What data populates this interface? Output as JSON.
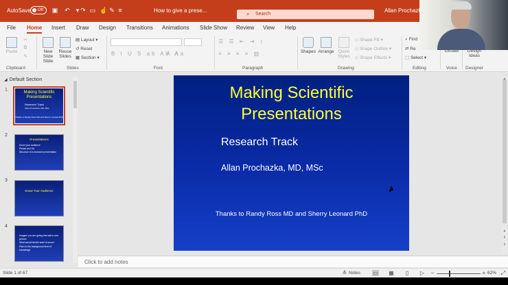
{
  "titlebar": {
    "autosave_label": "AutoSave",
    "autosave_state": "Off",
    "doc_title": "How to give a prese...",
    "search_placeholder": "Search",
    "user_name": "Allan Prochazka",
    "accent_color": "#c43e1c"
  },
  "tabs": [
    "File",
    "Home",
    "Insert",
    "Draw",
    "Design",
    "Transitions",
    "Animations",
    "Slide Show",
    "Review",
    "View",
    "Help"
  ],
  "active_tab": "Home",
  "ribbon": {
    "clipboard": {
      "paste": "Paste",
      "label": "Clipboard"
    },
    "slides": {
      "new_slide": "New Slide",
      "new_slide_2": "Slide",
      "reuse_slides": "Reuse",
      "reuse_slides_2": "Slides",
      "layout": "Layout",
      "reset": "Reset",
      "section": "Section",
      "label": "Slides"
    },
    "font": {
      "label": "Font"
    },
    "paragraph": {
      "label": "Paragraph"
    },
    "drawing": {
      "shapes": "Shapes",
      "arrange": "Arrange",
      "quick_styles": "Quick",
      "quick_styles_2": "Styles",
      "shape_fill": "Shape Fill",
      "shape_outline": "Shape Outline",
      "shape_effects": "Shape Effects",
      "label": "Drawing"
    },
    "editing": {
      "find": "Find",
      "replace": "Re",
      "select": "Select",
      "label": "Editing"
    },
    "voice": {
      "dictate": "Dictate",
      "label": "Voice"
    },
    "designer": {
      "design_ideas": "Design",
      "design_ideas_2": "Ideas",
      "label": "Designer"
    }
  },
  "section_name": "Default Section",
  "thumbnails": [
    {
      "number": "1",
      "title": "Making Scientific Presentations",
      "subtitle": "Research Track",
      "line": "Allan Prochazka, MD, MSc",
      "footer": "Thanks to Randy Ross MD and Sherry Leonard PhD"
    },
    {
      "number": "2",
      "title": "Presentations",
      "bullets": [
        "Know your audience",
        "Please and Do",
        "Structure of a research presentation"
      ]
    },
    {
      "number": "3",
      "title": "Know Your Audience"
    },
    {
      "number": "4",
      "bullets": [
        "Imagine you are giving this talk to one person.",
        "What would he/she want to know?",
        "Pitch to the background level of knowledge"
      ]
    }
  ],
  "slide": {
    "title_line1": "Making Scientific",
    "title_line2": "Presentations",
    "subtitle": "Research Track",
    "author": "Allan Prochazka, MD, MSc",
    "thanks": "Thanks to Randy Ross MD and Sherry Leonard PhD",
    "title_color": "#ffff33",
    "bg_color": "#0a2aa6"
  },
  "notes_placeholder": "Click to add notes",
  "statusbar": {
    "slide_counter": "Slide 1 of 67",
    "notes_label": "Notes",
    "zoom": "62%",
    "zoom_fraction": 0.62
  }
}
